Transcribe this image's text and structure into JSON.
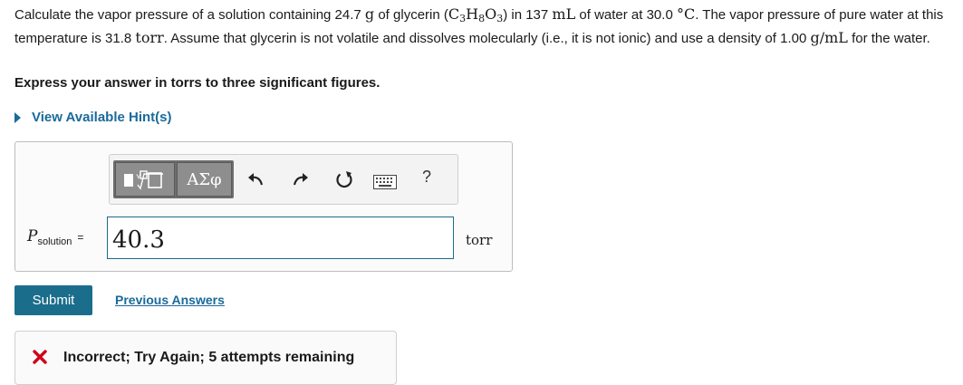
{
  "question": {
    "p1": "Calculate the vapor pressure of a solution containing 24.7",
    "u_g": "g",
    "p2": "of glycerin (",
    "formula_c": "C",
    "formula_c_sub": "3",
    "formula_h": "H",
    "formula_h_sub": "8",
    "formula_o": "O",
    "formula_o_sub": "3",
    "p3": ") in 137",
    "u_ml": "mL",
    "p4": "of water at 30.0",
    "u_degc": "°C",
    "p5": ". The vapor pressure of pure water at this temperature is 31.8",
    "u_torr": "torr",
    "p6": ". Assume that glycerin is not volatile and dissolves molecularly (i.e., it is not ionic) and use a density of 1.00",
    "u_gml": "g/mL",
    "p7": "for the water."
  },
  "instruction": "Express your answer in torrs to three significant figures.",
  "hint_link": "View Available Hint(s)",
  "toolbar": {
    "greek_label": "ΑΣφ",
    "help_label": "?",
    "icons": [
      "templates-icon",
      "greek-letters-icon",
      "undo-icon",
      "redo-icon",
      "reset-icon",
      "keyboard-icon",
      "help-icon"
    ]
  },
  "answer": {
    "var_symbol": "P",
    "var_subscript": "solution",
    "equals": "=",
    "value": "40.3",
    "unit": "torr"
  },
  "submit_label": "Submit",
  "previous_answers_label": "Previous Answers",
  "feedback": {
    "message": "Incorrect; Try Again; 5 attempts remaining",
    "icon": "x-icon",
    "icon_color": "#d0021b"
  },
  "colors": {
    "link": "#1a6a9a",
    "submit_bg": "#1b6d8c",
    "input_border": "#1c6b86"
  }
}
